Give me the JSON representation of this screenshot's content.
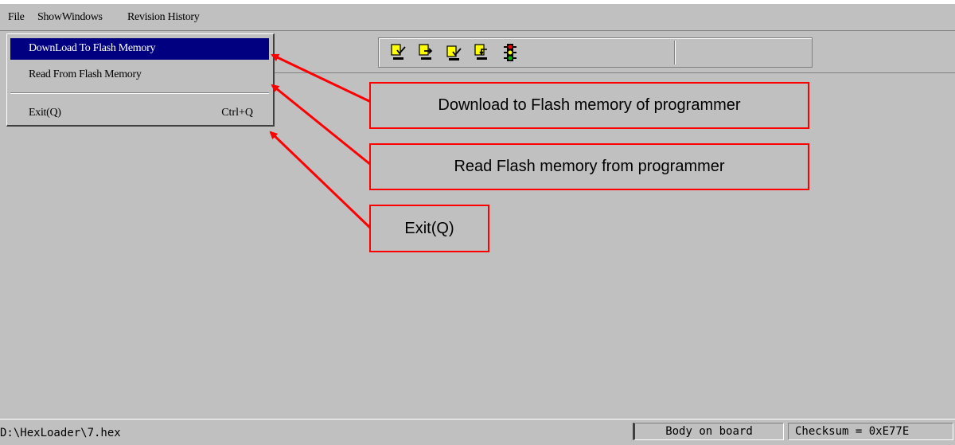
{
  "menubar": {
    "items": [
      "File",
      "ShowWindows",
      "Revision History"
    ]
  },
  "file_menu": {
    "items": [
      {
        "label": "DownLoad To Flash Memory",
        "shortcut": ""
      },
      {
        "label": "Read From Flash Memory",
        "shortcut": ""
      },
      {
        "label": "Exit(Q)",
        "shortcut": "Ctrl+Q"
      }
    ]
  },
  "toolbar": {
    "buttons": [
      "download-check-icon",
      "download-arrow-icon",
      "read-check-icon",
      "read-arrow-icon",
      "traffic-light-icon"
    ]
  },
  "callouts": {
    "download": "Download to Flash memory of programmer",
    "read": "Read Flash memory from programmer",
    "exit": "Exit(Q)"
  },
  "statusbar": {
    "path": "D:\\HexLoader\\7.hex",
    "board": "Body on board",
    "checksum": "Checksum = 0xE77E"
  },
  "colors": {
    "background": "#c0c0c0",
    "highlight": "#000080",
    "annotation": "#ff0000"
  }
}
